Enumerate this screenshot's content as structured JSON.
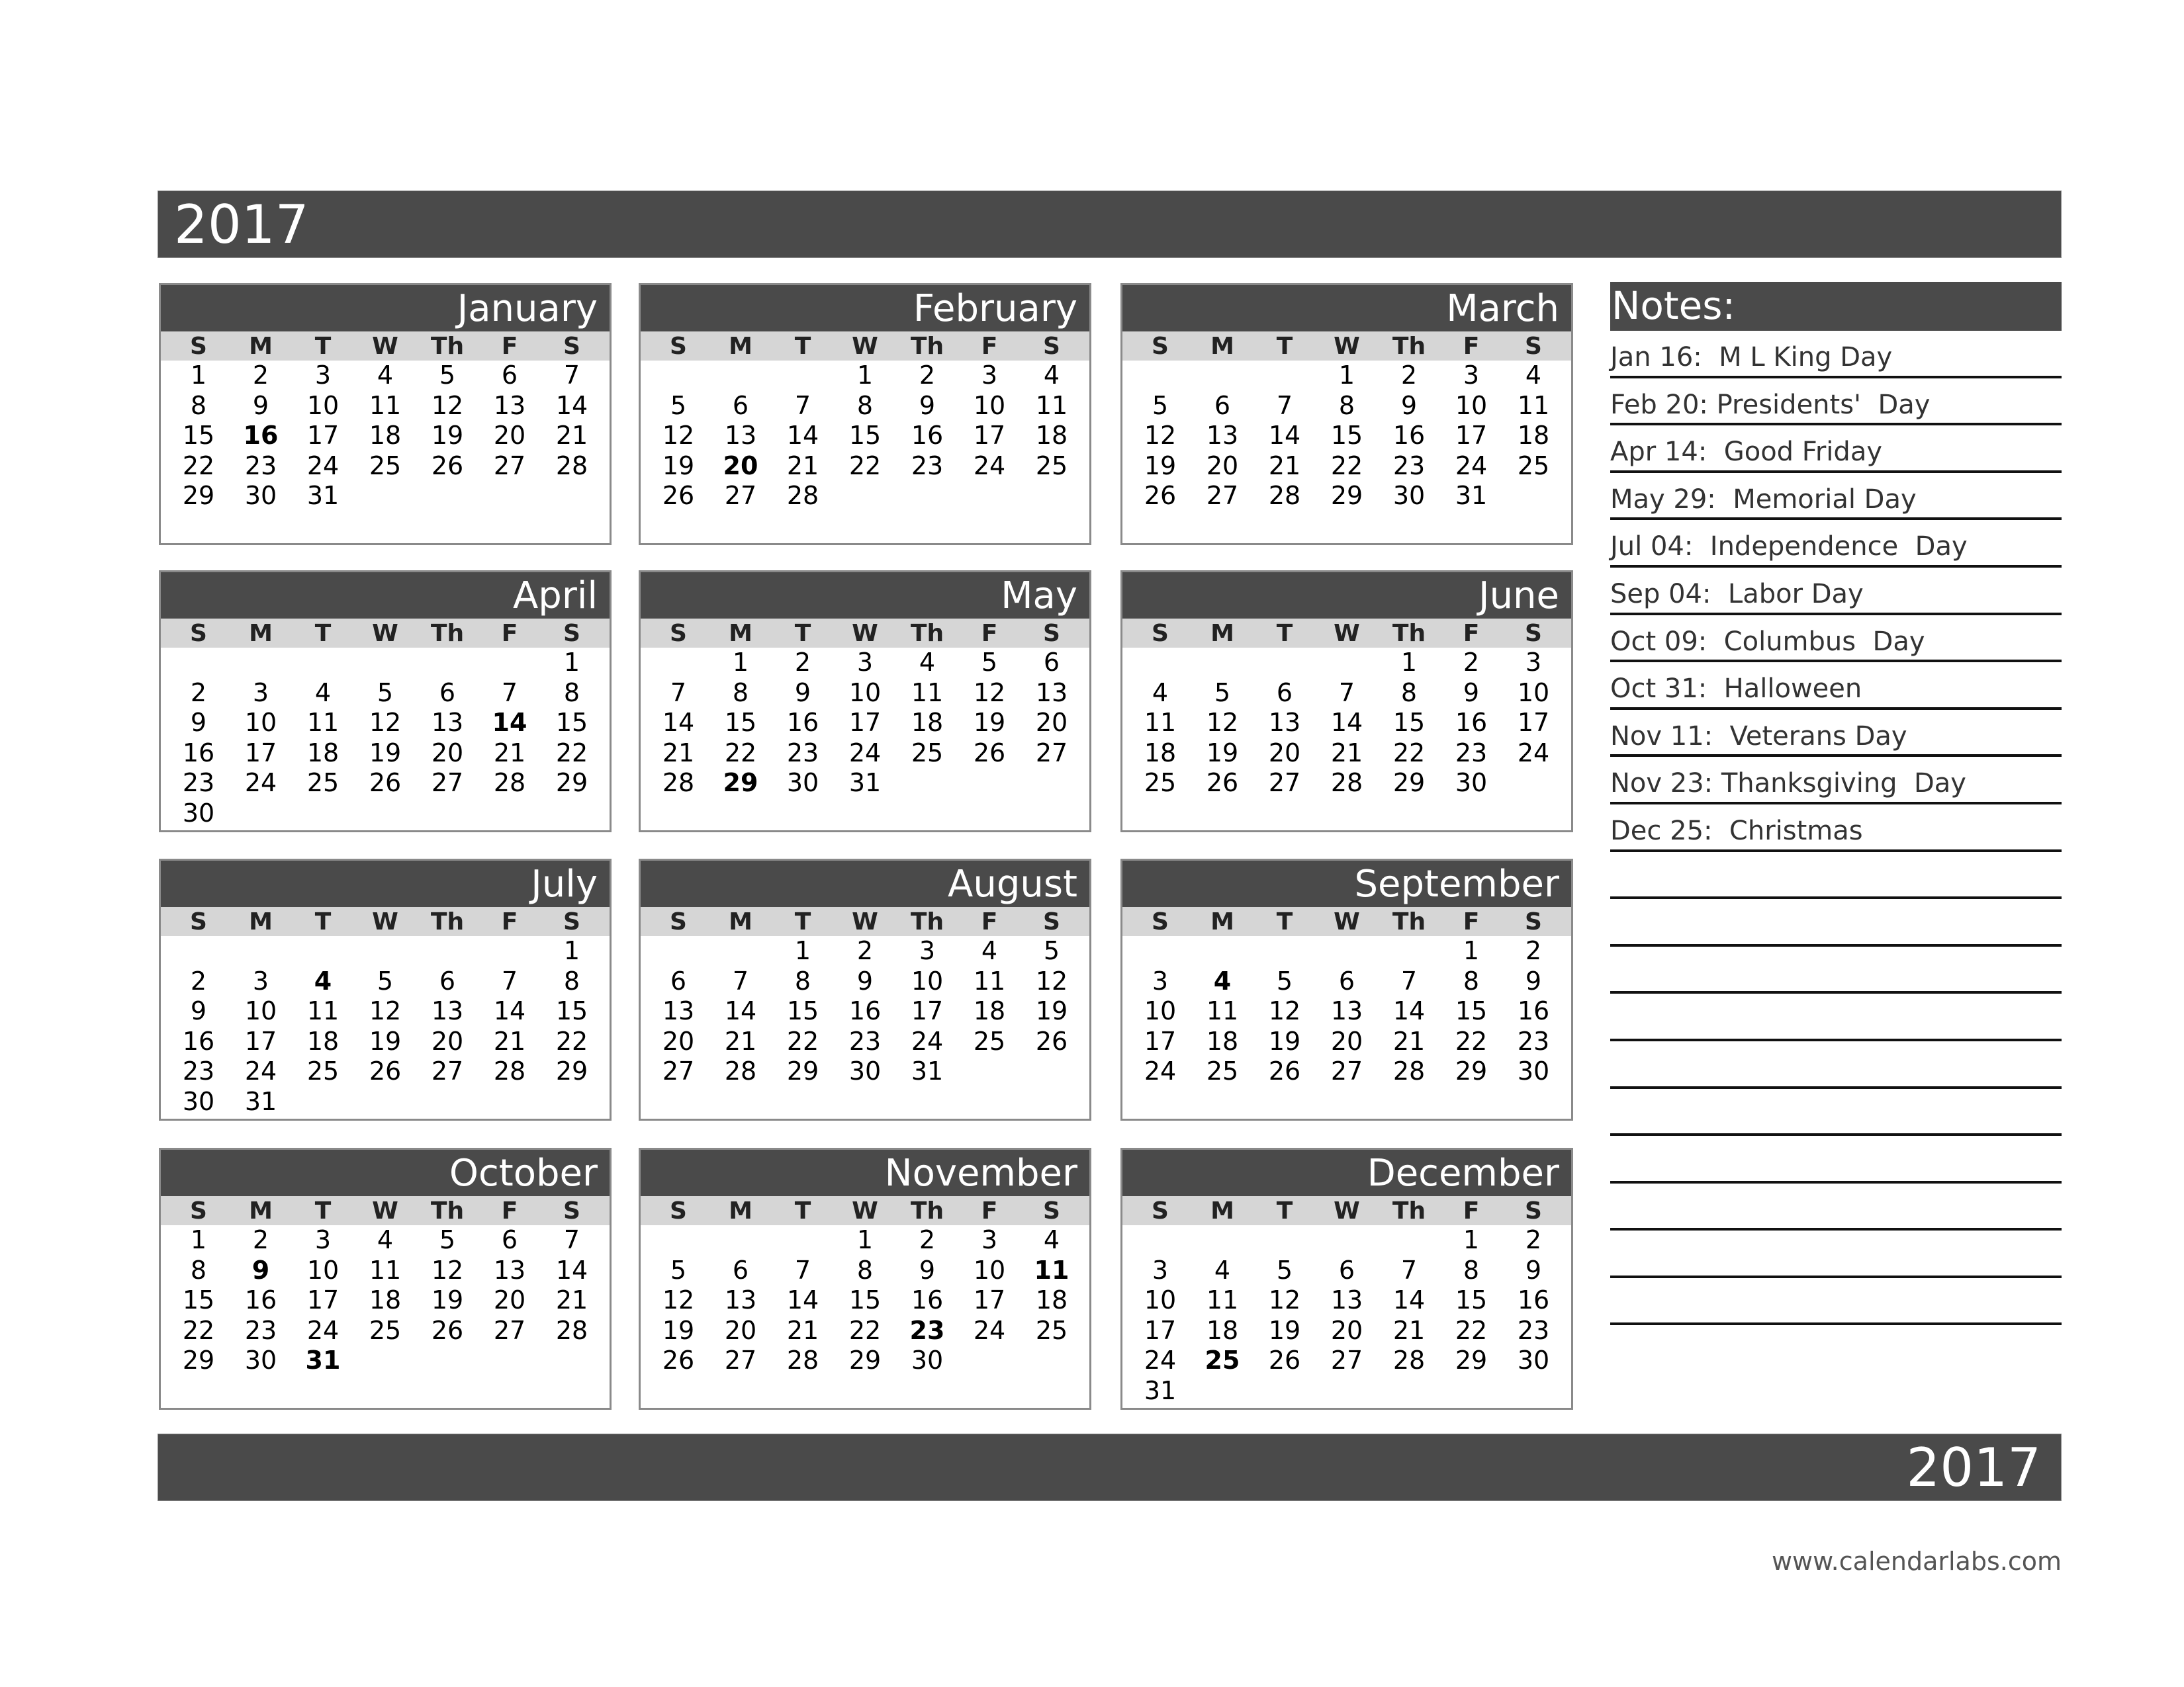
{
  "year_title": "2017",
  "year_footer": "2017",
  "weekdays": [
    "S",
    "M",
    "T",
    "W",
    "Th",
    "F",
    "S"
  ],
  "months": [
    {
      "name": "January",
      "start": 0,
      "days": 31,
      "holidays": [
        16
      ]
    },
    {
      "name": "February",
      "start": 3,
      "days": 28,
      "holidays": [
        20
      ]
    },
    {
      "name": "March",
      "start": 3,
      "days": 31,
      "holidays": []
    },
    {
      "name": "April",
      "start": 6,
      "days": 30,
      "holidays": [
        14
      ]
    },
    {
      "name": "May",
      "start": 1,
      "days": 31,
      "holidays": [
        29
      ]
    },
    {
      "name": "June",
      "start": 4,
      "days": 30,
      "holidays": []
    },
    {
      "name": "July",
      "start": 6,
      "days": 31,
      "holidays": [
        4
      ]
    },
    {
      "name": "August",
      "start": 2,
      "days": 31,
      "holidays": []
    },
    {
      "name": "September",
      "start": 5,
      "days": 30,
      "holidays": [
        4
      ]
    },
    {
      "name": "October",
      "start": 0,
      "days": 31,
      "holidays": [
        9,
        31
      ]
    },
    {
      "name": "November",
      "start": 3,
      "days": 30,
      "holidays": [
        11,
        23
      ]
    },
    {
      "name": "December",
      "start": 5,
      "days": 31,
      "holidays": [
        25
      ]
    }
  ],
  "notes": {
    "title": "Notes:",
    "items": [
      "Jan 16:  M L King Day",
      "Feb 20: Presidents'  Day",
      "Apr 14:  Good Friday",
      "May 29:  Memorial Day",
      "Jul 04:  Independence  Day",
      "Sep 04:  Labor Day",
      "Oct 09:  Columbus  Day",
      "Oct 31:  Halloween",
      "Nov 11:  Veterans Day",
      "Nov 23: Thanksgiving  Day",
      "Dec 25:  Christmas",
      "",
      "",
      "",
      "",
      "",
      "",
      "",
      "",
      "",
      ""
    ]
  },
  "website": "www.calendarlabs.com"
}
